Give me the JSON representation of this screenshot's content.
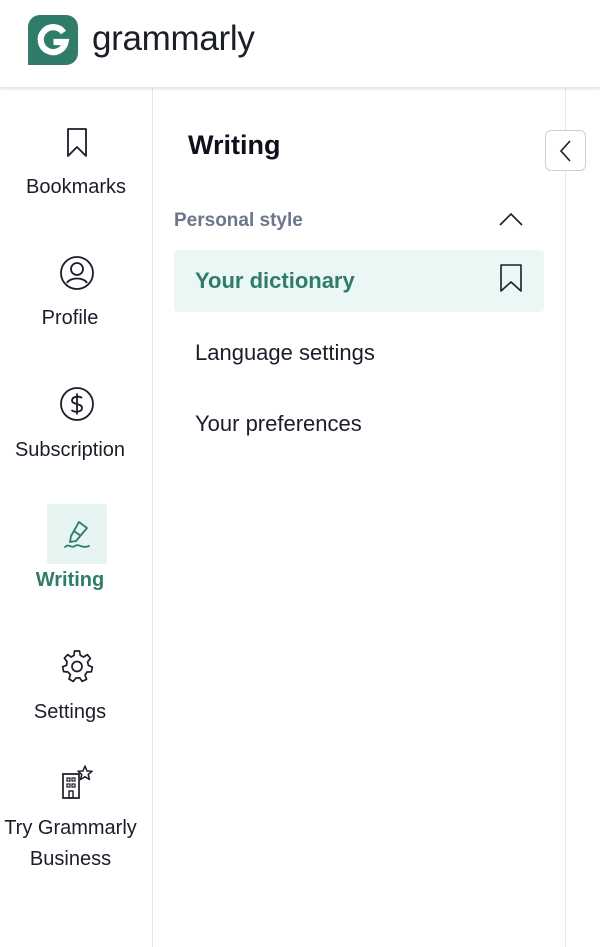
{
  "brand": {
    "name": "grammarly",
    "color": "#15c39a",
    "dark": "#2f7c6a"
  },
  "sidebar": {
    "items": [
      {
        "label": "Bookmarks",
        "icon": "bookmark-icon",
        "active": false
      },
      {
        "label": "Profile",
        "icon": "profile-icon",
        "active": false
      },
      {
        "label": "Subscription",
        "icon": "dollar-icon",
        "active": false
      },
      {
        "label": "Writing",
        "icon": "pen-icon",
        "active": true
      },
      {
        "label": "Settings",
        "icon": "gear-icon",
        "active": false
      },
      {
        "label": "Try Grammarly Business",
        "icon": "building-star-icon",
        "active": false
      }
    ]
  },
  "panel": {
    "title": "Writing",
    "section": {
      "title": "Personal style",
      "expanded": true,
      "items": [
        {
          "label": "Your dictionary",
          "active": true
        },
        {
          "label": "Language settings",
          "active": false
        },
        {
          "label": "Your preferences",
          "active": false
        }
      ]
    }
  },
  "colors": {
    "active_text": "#2f7c6a",
    "active_bg": "#eaf7f4",
    "muted": "#6d758d",
    "border": "#e4e6ea"
  }
}
